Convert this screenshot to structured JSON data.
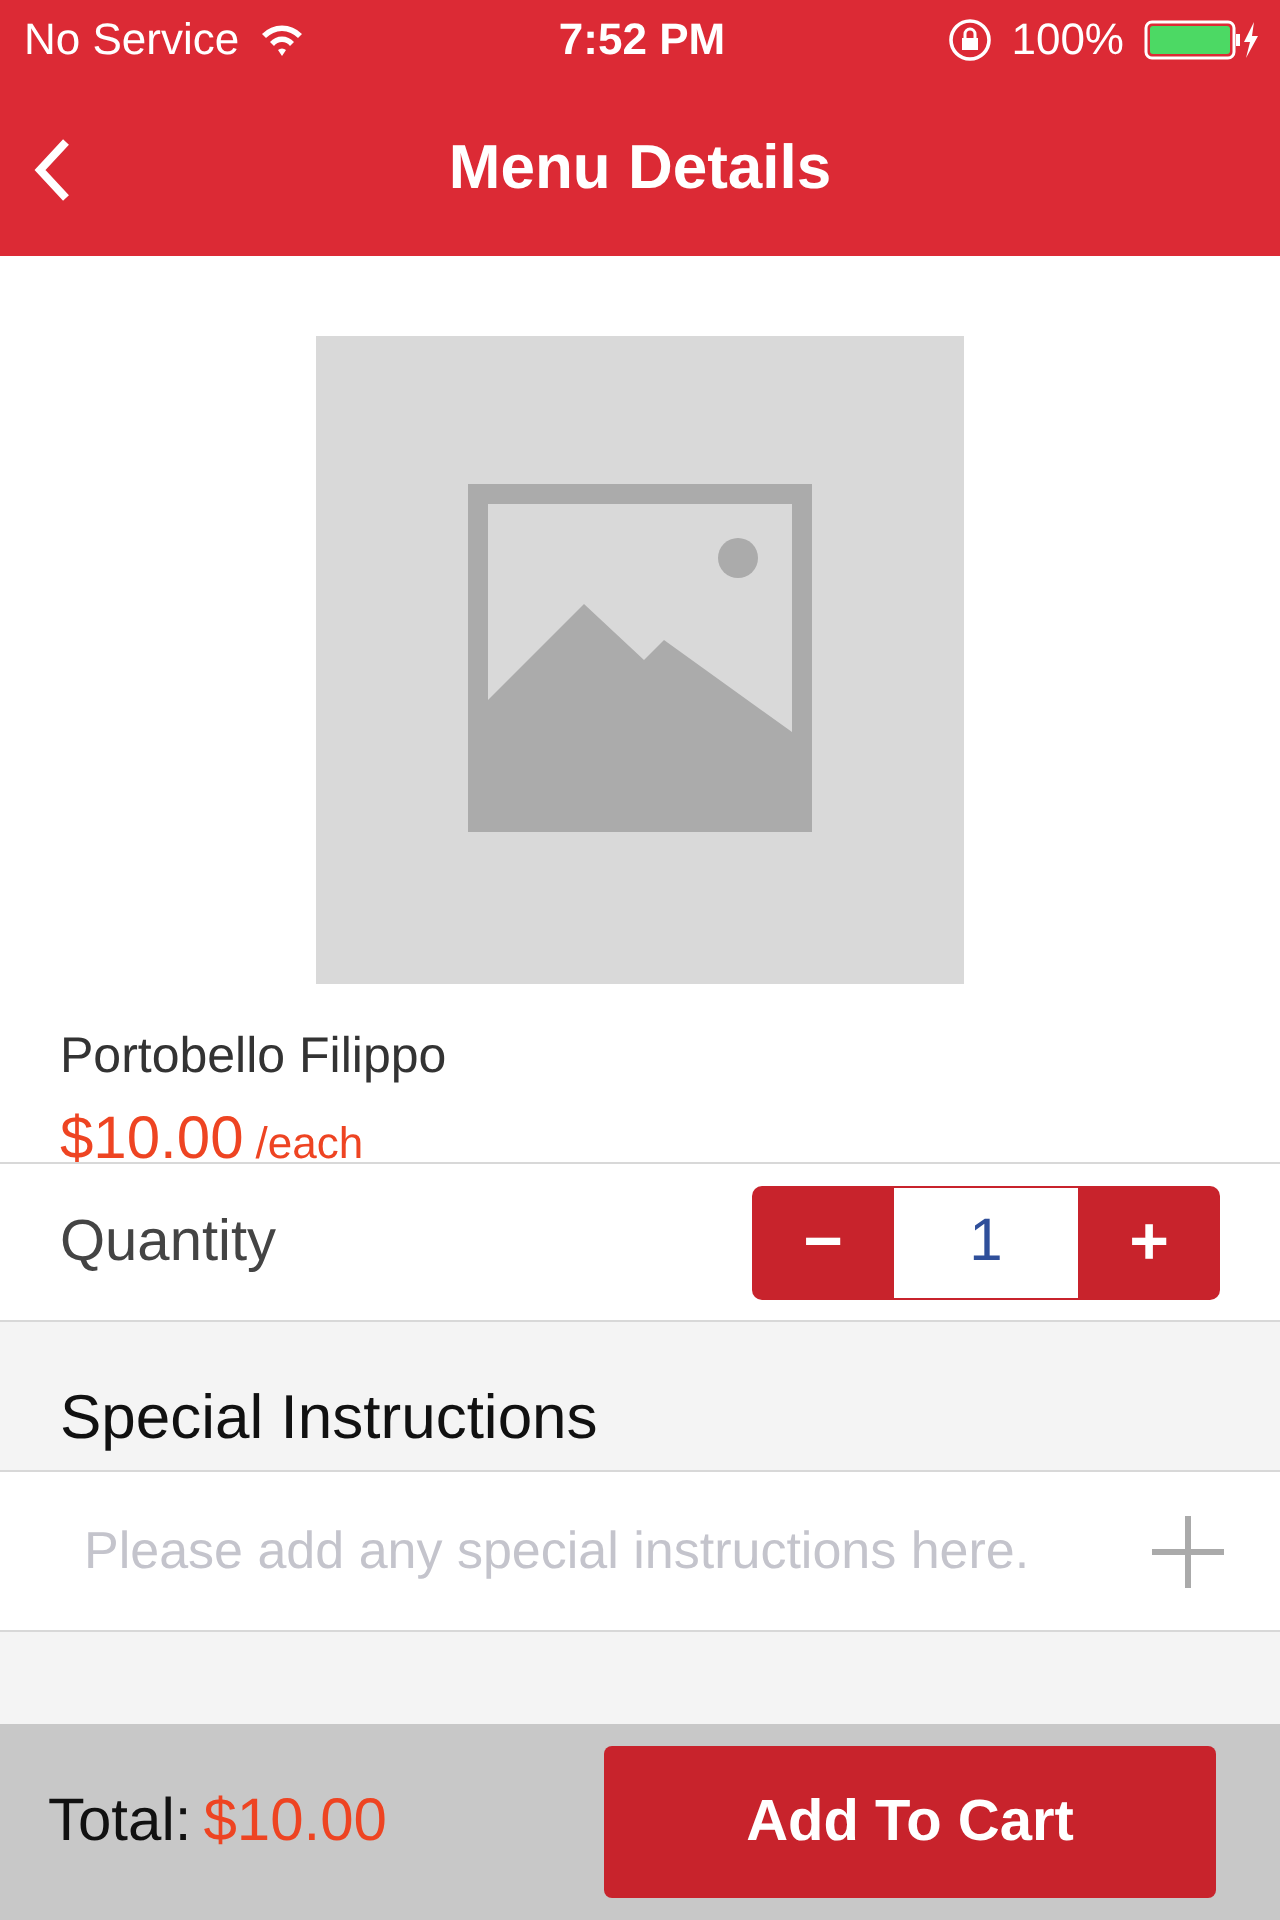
{
  "status_bar": {
    "carrier": "No Service",
    "time": "7:52 PM",
    "battery": "100%"
  },
  "nav": {
    "title": "Menu Details"
  },
  "item": {
    "name": "Portobello Filippo",
    "price": "$10.00",
    "unit": "/each"
  },
  "quantity": {
    "label": "Quantity",
    "minus": "−",
    "value": "1",
    "plus": "+"
  },
  "special_instructions": {
    "title": "Special Instructions",
    "placeholder": "Please add any special instructions here."
  },
  "footer": {
    "total_label": "Total:",
    "total": "$10.00",
    "button": "Add To Cart"
  }
}
